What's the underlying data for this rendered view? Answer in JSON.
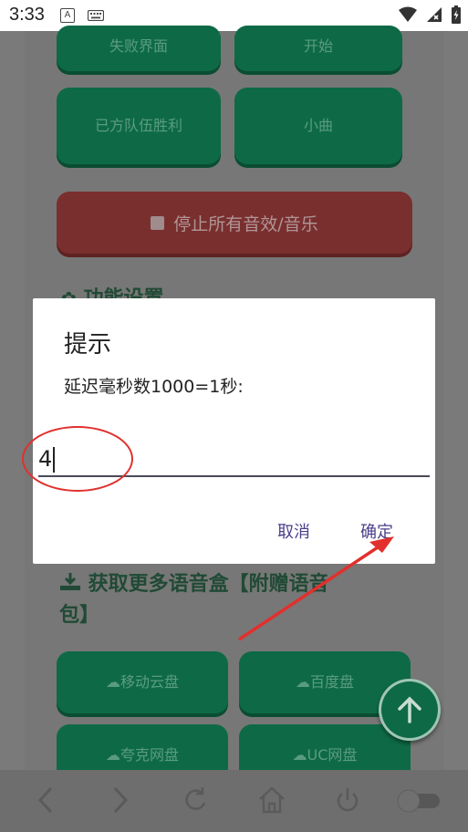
{
  "status": {
    "time": "3:33",
    "a_badge": "A"
  },
  "page": {
    "buttons": [
      {
        "label": "失败界面"
      },
      {
        "label": "开始"
      },
      {
        "label": "已方队伍胜利"
      },
      {
        "label": "小曲"
      }
    ],
    "stop_button": "停止所有音效/音乐",
    "section_settings": "功能设置",
    "section_more": "获取更多语音盒【附赠语音包】",
    "section_more_line1": "获取更多语音盒【附赠语音",
    "section_more_line2": "包】",
    "cloud_buttons": [
      {
        "label": "移动云盘"
      },
      {
        "label": "百度盘"
      },
      {
        "label": "夸克网盘"
      },
      {
        "label": "UC网盘"
      }
    ]
  },
  "dialog": {
    "title": "提示",
    "message": "延迟毫秒数1000=1秒:",
    "input_value": "4",
    "cancel_label": "取消",
    "ok_label": "确定"
  },
  "colors": {
    "annotation": "#e1302d",
    "dialog_action": "#4a3e8a",
    "button_green": "#0e6a46"
  }
}
